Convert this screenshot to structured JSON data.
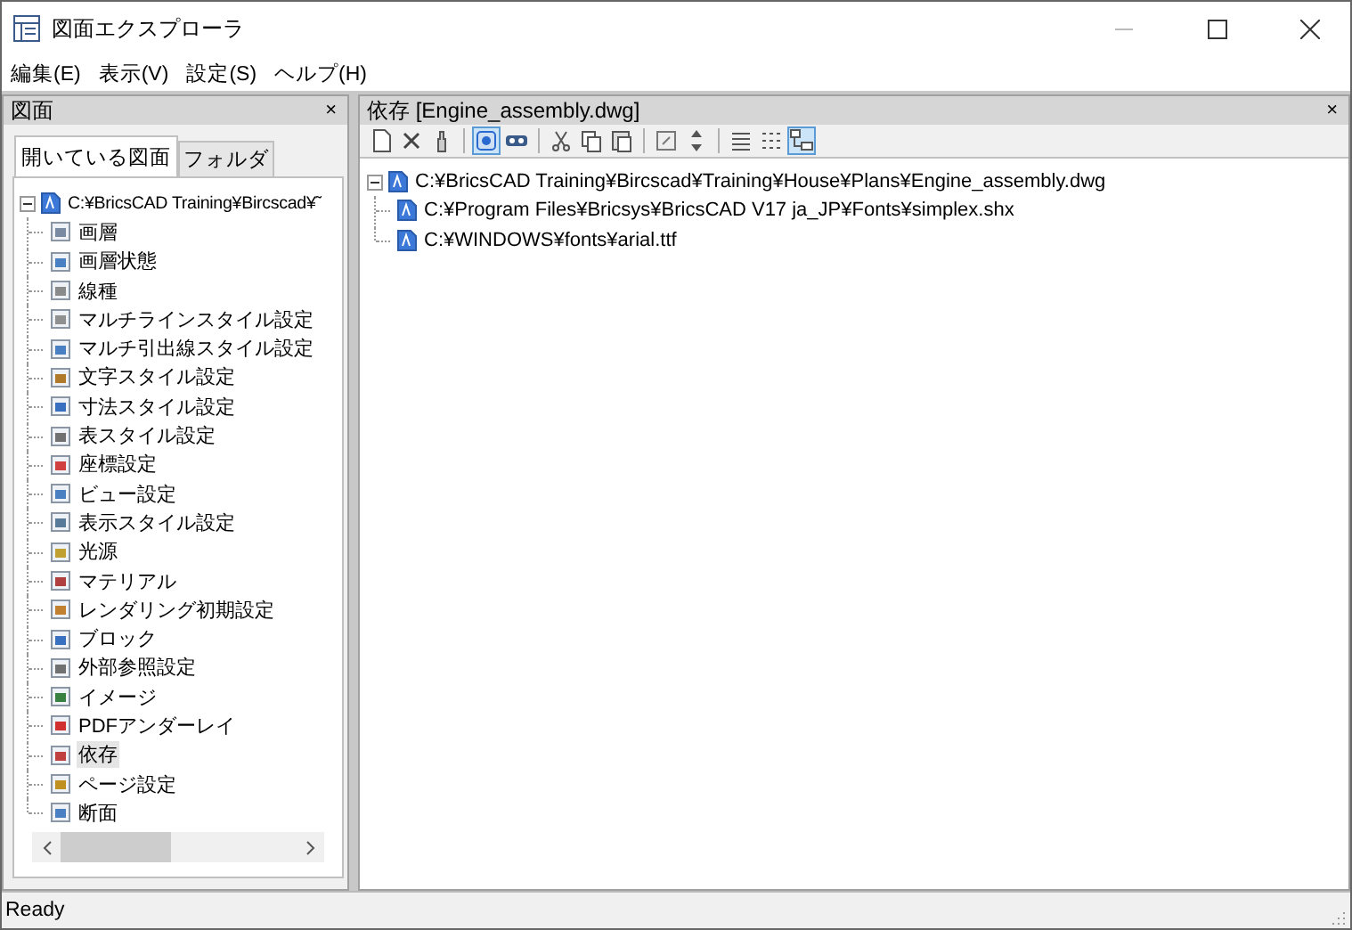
{
  "window": {
    "title": "図面エクスプローラ"
  },
  "menu": [
    "編集(E)",
    "表示(V)",
    "設定(S)",
    "ヘルプ(H)"
  ],
  "left_panel": {
    "title": "図面",
    "close": "×",
    "tabs": [
      {
        "label": "開いている図面",
        "selected": true
      },
      {
        "label": "フォルダ",
        "selected": false
      }
    ],
    "tree": {
      "label": "C:¥BricsCAD Training¥Bircscad¥˜",
      "expanded": true,
      "children": [
        {
          "label": "画層",
          "selected": false
        },
        {
          "label": "画層状態",
          "selected": false
        },
        {
          "label": "線種",
          "selected": false
        },
        {
          "label": "マルチラインスタイル設定",
          "selected": false
        },
        {
          "label": "マルチ引出線スタイル設定",
          "selected": false
        },
        {
          "label": "文字スタイル設定",
          "selected": false
        },
        {
          "label": "寸法スタイル設定",
          "selected": false
        },
        {
          "label": "表スタイル設定",
          "selected": false
        },
        {
          "label": "座標設定",
          "selected": false
        },
        {
          "label": "ビュー設定",
          "selected": false
        },
        {
          "label": "表示スタイル設定",
          "selected": false
        },
        {
          "label": "光源",
          "selected": false
        },
        {
          "label": "マテリアル",
          "selected": false
        },
        {
          "label": "レンダリング初期設定",
          "selected": false
        },
        {
          "label": "ブロック",
          "selected": false
        },
        {
          "label": "外部参照設定",
          "selected": false
        },
        {
          "label": "イメージ",
          "selected": false
        },
        {
          "label": "PDFアンダーレイ",
          "selected": false
        },
        {
          "label": "依存",
          "selected": true
        },
        {
          "label": "ページ設定",
          "selected": false
        },
        {
          "label": "断面",
          "selected": false
        }
      ]
    }
  },
  "right_panel": {
    "title": "依存 [Engine_assembly.dwg]",
    "close": "×",
    "toolbar": [
      {
        "kind": "button",
        "selected": false
      },
      {
        "kind": "button",
        "selected": false
      },
      {
        "kind": "button",
        "selected": false
      },
      {
        "kind": "separator"
      },
      {
        "kind": "button",
        "selected": true
      },
      {
        "kind": "button",
        "selected": false
      },
      {
        "kind": "separator"
      },
      {
        "kind": "button",
        "selected": false
      },
      {
        "kind": "button",
        "selected": false
      },
      {
        "kind": "button",
        "selected": false
      },
      {
        "kind": "separator"
      },
      {
        "kind": "button",
        "selected": false
      },
      {
        "kind": "button",
        "selected": false
      },
      {
        "kind": "separator"
      },
      {
        "kind": "button",
        "selected": false
      },
      {
        "kind": "button",
        "selected": false
      },
      {
        "kind": "button",
        "selected": true
      }
    ],
    "tree": {
      "label": "C:¥BricsCAD Training¥Bircscad¥Training¥House¥Plans¥Engine_assembly.dwg",
      "expanded": true,
      "children": [
        {
          "label": "C:¥Program Files¥Bricsys¥BricsCAD V17 ja_JP¥Fonts¥simplex.shx"
        },
        {
          "label": "C:¥WINDOWS¥fonts¥arial.ttf"
        }
      ]
    }
  },
  "status_bar": "Ready"
}
